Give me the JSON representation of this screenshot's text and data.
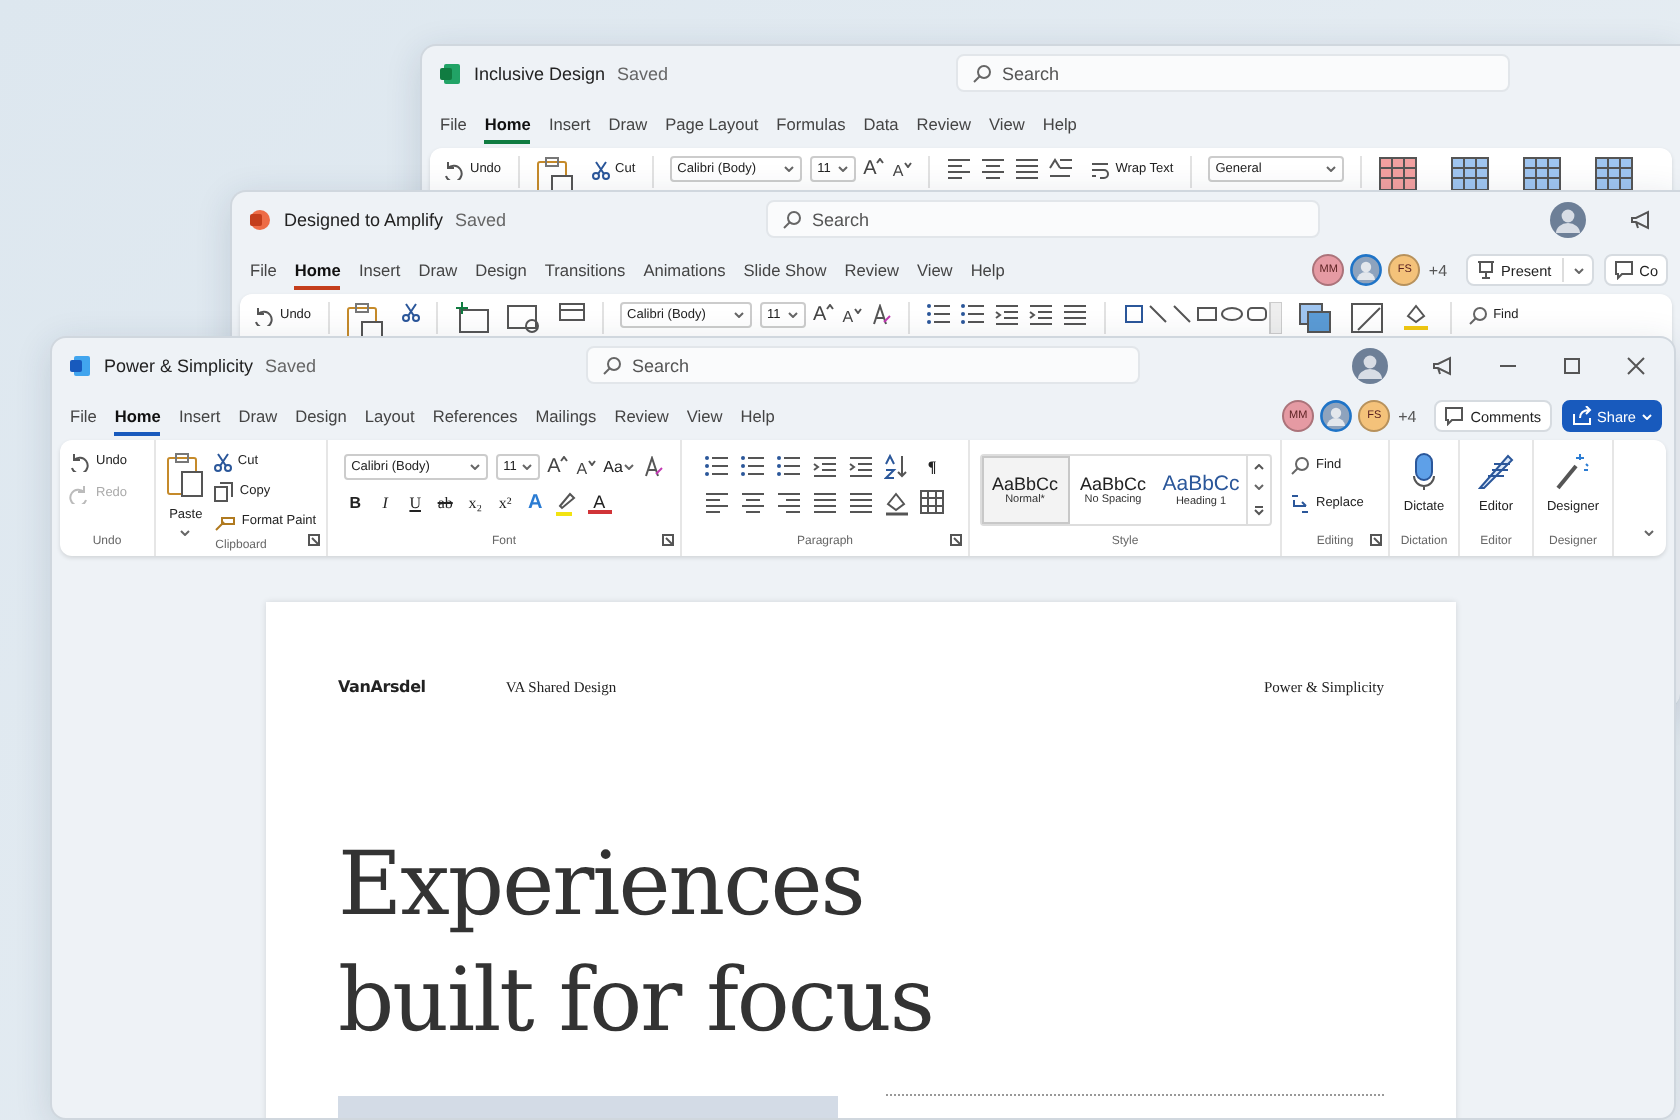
{
  "windows": [
    {
      "kind": "excel",
      "active": false,
      "title": "Inclusive Design",
      "status": "Saved",
      "search": {
        "placeholder": "Search"
      },
      "tabs": [
        {
          "label": "File",
          "selected": false
        },
        {
          "label": "Home",
          "selected": true
        },
        {
          "label": "Insert",
          "selected": false
        },
        {
          "label": "Draw",
          "selected": false
        },
        {
          "label": "Page Layout",
          "selected": false
        },
        {
          "label": "Formulas",
          "selected": false
        },
        {
          "label": "Data",
          "selected": false
        },
        {
          "label": "Review",
          "selected": false
        },
        {
          "label": "View",
          "selected": false
        },
        {
          "label": "Help",
          "selected": false
        }
      ],
      "ribbon": {
        "undo": "Undo",
        "cut": "Cut",
        "font": "Calibri (Body)",
        "size": "11",
        "size_buttons": [
          "A",
          "A"
        ],
        "wrap": "Wrap Text",
        "number_format": "General"
      }
    },
    {
      "kind": "powerpoint",
      "active": false,
      "title": "Designed to Amplify",
      "status": "Saved",
      "search": {
        "placeholder": "Search"
      },
      "tabs": [
        {
          "label": "File",
          "selected": false
        },
        {
          "label": "Home",
          "selected": true
        },
        {
          "label": "Insert",
          "selected": false
        },
        {
          "label": "Draw",
          "selected": false
        },
        {
          "label": "Design",
          "selected": false
        },
        {
          "label": "Transitions",
          "selected": false
        },
        {
          "label": "Animations",
          "selected": false
        },
        {
          "label": "Slide Show",
          "selected": false
        },
        {
          "label": "Review",
          "selected": false
        },
        {
          "label": "View",
          "selected": false
        },
        {
          "label": "Help",
          "selected": false
        }
      ],
      "collaborators": [
        {
          "kind": "initials",
          "initials": "MM",
          "color": "#e59aa3"
        },
        {
          "kind": "photo"
        },
        {
          "kind": "initials",
          "initials": "FS",
          "color": "#f4c27a"
        }
      ],
      "others_count": "+4",
      "actions": [
        {
          "kind": "present",
          "label": "Present"
        },
        {
          "kind": "comments",
          "label": "Co"
        }
      ],
      "ribbon": {
        "undo": "Undo",
        "font": "Calibri (Body)",
        "size": "11",
        "size_buttons": [
          "A",
          "A"
        ],
        "find": "Find"
      }
    },
    {
      "kind": "word",
      "active": true,
      "title": "Power & Simplicity",
      "status": "Saved",
      "search": {
        "placeholder": "Search"
      },
      "tabs": [
        {
          "label": "File",
          "selected": false
        },
        {
          "label": "Home",
          "selected": true
        },
        {
          "label": "Insert",
          "selected": false
        },
        {
          "label": "Draw",
          "selected": false
        },
        {
          "label": "Design",
          "selected": false
        },
        {
          "label": "Layout",
          "selected": false
        },
        {
          "label": "References",
          "selected": false
        },
        {
          "label": "Mailings",
          "selected": false
        },
        {
          "label": "Review",
          "selected": false
        },
        {
          "label": "View",
          "selected": false
        },
        {
          "label": "Help",
          "selected": false
        }
      ],
      "collaborators": [
        {
          "kind": "initials",
          "initials": "MM",
          "color": "#e59aa3"
        },
        {
          "kind": "photo"
        },
        {
          "kind": "initials",
          "initials": "FS",
          "color": "#f4c27a"
        }
      ],
      "others_count": "+4",
      "actions": [
        {
          "kind": "comments",
          "label": "Comments"
        },
        {
          "kind": "share",
          "label": "Share"
        }
      ],
      "ribbon": {
        "groups": [
          {
            "kind": "undo",
            "items": [
              {
                "kind": "undo",
                "label": "Undo",
                "disabled": false
              },
              {
                "kind": "redo",
                "label": "Redo",
                "disabled": true
              }
            ],
            "label": "Undo"
          },
          {
            "kind": "clipboard",
            "paste": "Paste",
            "items": [
              {
                "kind": "cut",
                "label": "Cut"
              },
              {
                "kind": "copy",
                "label": "Copy"
              },
              {
                "kind": "painter",
                "label": "Format Paint"
              }
            ],
            "label": "Clipboard"
          },
          {
            "kind": "font",
            "font": "Calibri (Body)",
            "size": "11",
            "size_buttons": [
              "A",
              "A"
            ],
            "case_button": "Aa",
            "format_buttons": [
              {
                "kind": "bold",
                "label": "B"
              },
              {
                "kind": "italic",
                "label": "I"
              },
              {
                "kind": "underline",
                "label": "U"
              },
              {
                "kind": "strike",
                "label": "ab"
              },
              {
                "kind": "subscript",
                "label": "x₂"
              },
              {
                "kind": "superscript",
                "label": "x²"
              },
              {
                "kind": "effects",
                "label": "A"
              },
              {
                "kind": "highlight"
              },
              {
                "kind": "color",
                "label": "A"
              }
            ],
            "label": "Font"
          },
          {
            "kind": "paragraph",
            "pilcrow": "¶",
            "label": "Paragraph"
          },
          {
            "kind": "styles",
            "styles": [
              {
                "sample": "AaBbCc",
                "name": "Normal*",
                "selected": true
              },
              {
                "sample": "AaBbCc",
                "name": "No Spacing",
                "selected": false
              },
              {
                "sample": "AaBbCc",
                "name": "Heading 1",
                "selected": false
              }
            ],
            "label": "Style"
          },
          {
            "kind": "editing",
            "items": [
              {
                "kind": "find",
                "label": "Find"
              },
              {
                "kind": "replace",
                "label": "Replace"
              }
            ],
            "label": "Editing"
          },
          {
            "kind": "dictation",
            "button": "Dictate",
            "label": "Dictation"
          },
          {
            "kind": "editor",
            "button": "Editor",
            "label": "Editor"
          },
          {
            "kind": "designer",
            "button": "Designer",
            "label": "Designer"
          }
        ]
      },
      "document": {
        "logo": "VanArsdel",
        "header_left": "VA Shared Design",
        "header_right": "Power & Simplicity",
        "heading": "Experiences built for focus"
      }
    }
  ]
}
